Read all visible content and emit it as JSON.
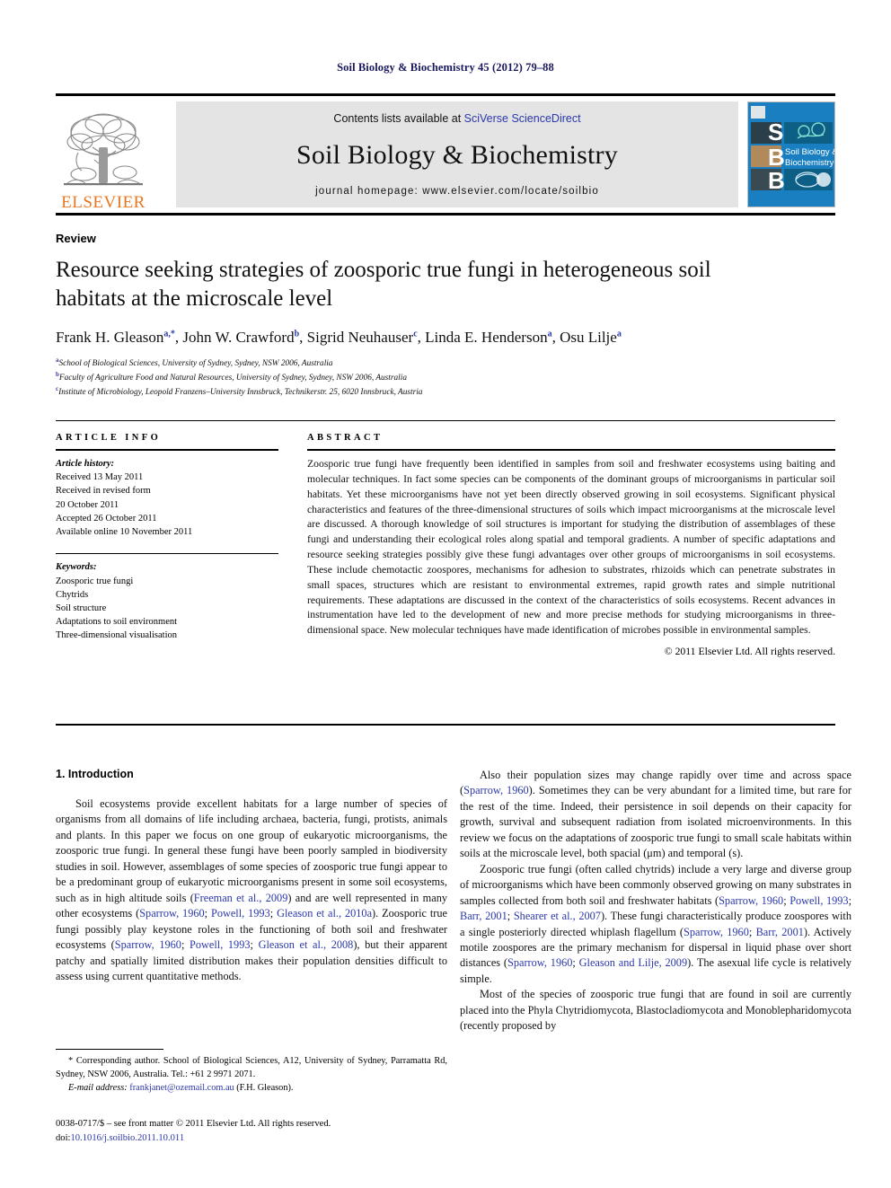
{
  "running_head": "Soil Biology & Biochemistry 45 (2012) 79–88",
  "masthead": {
    "publisher_name": "ELSEVIER",
    "contents_prefix": "Contents lists available at ",
    "contents_link": "SciVerse ScienceDirect",
    "journal_title": "Soil Biology & Biochemistry",
    "homepage": "journal homepage: www.elsevier.com/locate/soilbio",
    "cover_title_line1": "Soil Biology &",
    "cover_title_line2": "Biochemistry",
    "cover_letters": [
      "S",
      "B",
      "B"
    ],
    "colors": {
      "elsevier_orange": "#e87722",
      "link_blue": "#2b38a8",
      "cover_blue": "#1a7fc1",
      "contents_grey": "#e4e4e4",
      "running_head_navy": "#1a1a5e"
    }
  },
  "article": {
    "doctype": "Review",
    "title": "Resource seeking strategies of zoosporic true fungi in heterogeneous soil habitats at the microscale level",
    "authors": [
      {
        "name": "Frank H. Gleason",
        "marks": "a,*"
      },
      {
        "name": "John W. Crawford",
        "marks": "b"
      },
      {
        "name": "Sigrid Neuhauser",
        "marks": "c"
      },
      {
        "name": "Linda E. Henderson",
        "marks": "a"
      },
      {
        "name": "Osu Lilje",
        "marks": "a"
      }
    ],
    "affiliations": [
      {
        "mark": "a",
        "text": "School of Biological Sciences, University of Sydney, Sydney, NSW 2006, Australia"
      },
      {
        "mark": "b",
        "text": "Faculty of Agriculture Food and Natural Resources, University of Sydney, Sydney, NSW 2006, Australia"
      },
      {
        "mark": "c",
        "text": "Institute of Microbiology, Leopold Franzens–University Innsbruck, Technikerstr. 25, 6020 Innsbruck, Austria"
      }
    ]
  },
  "article_info": {
    "heading": "ARTICLE INFO",
    "history_label": "Article history:",
    "history": [
      "Received 13 May 2011",
      "Received in revised form",
      "20 October 2011",
      "Accepted 26 October 2011",
      "Available online 10 November 2011"
    ],
    "keywords_label": "Keywords:",
    "keywords": [
      "Zoosporic true fungi",
      "Chytrids",
      "Soil structure",
      "Adaptations to soil environment",
      "Three-dimensional visualisation"
    ]
  },
  "abstract": {
    "heading": "ABSTRACT",
    "text": "Zoosporic true fungi have frequently been identified in samples from soil and freshwater ecosystems using baiting and molecular techniques. In fact some species can be components of the dominant groups of microorganisms in particular soil habitats. Yet these microorganisms have not yet been directly observed growing in soil ecosystems. Significant physical characteristics and features of the three-dimensional structures of soils which impact microorganisms at the microscale level are discussed. A thorough knowledge of soil structures is important for studying the distribution of assemblages of these fungi and understanding their ecological roles along spatial and temporal gradients. A number of specific adaptations and resource seeking strategies possibly give these fungi advantages over other groups of microorganisms in soil ecosystems. These include chemotactic zoospores, mechanisms for adhesion to substrates, rhizoids which can penetrate substrates in small spaces, structures which are resistant to environmental extremes, rapid growth rates and simple nutritional requirements. These adaptations are discussed in the context of the characteristics of soils ecosystems. Recent advances in instrumentation have led to the development of new and more precise methods for studying microorganisms in three-dimensional space. New molecular techniques have made identification of microbes possible in environmental samples.",
    "copyright": "© 2011 Elsevier Ltd. All rights reserved."
  },
  "body": {
    "section_heading": "1. Introduction",
    "left_paragraph_1_parts": [
      {
        "t": "Soil ecosystems provide excellent habitats for a large number of species of organisms from all domains of life including archaea, bacteria, fungi, protists, animals and plants. In this paper we focus on one group of eukaryotic microorganisms, the zoosporic true fungi. In general these fungi have been poorly sampled in biodiversity studies in soil. However, assemblages of some species of zoosporic true fungi appear to be a predominant group of eukaryotic microorganisms present in some soil ecosystems, such as in high altitude soils (",
        "c": false
      },
      {
        "t": "Freeman et al., 2009",
        "c": true
      },
      {
        "t": ") and are well represented in many other ecosystems (",
        "c": false
      },
      {
        "t": "Sparrow, 1960",
        "c": true
      },
      {
        "t": "; ",
        "c": false
      },
      {
        "t": "Powell, 1993",
        "c": true
      },
      {
        "t": "; ",
        "c": false
      },
      {
        "t": "Gleason et al., 2010a",
        "c": true
      },
      {
        "t": "). Zoosporic true fungi possibly play keystone roles in the functioning of both soil and freshwater ecosystems (",
        "c": false
      },
      {
        "t": "Sparrow, 1960",
        "c": true
      },
      {
        "t": "; ",
        "c": false
      },
      {
        "t": "Powell, 1993",
        "c": true
      },
      {
        "t": "; ",
        "c": false
      },
      {
        "t": "Gleason et al., 2008",
        "c": true
      },
      {
        "t": "), but their apparent patchy and spatially limited distribution makes their population densities difficult to assess using current quantitative methods.",
        "c": false
      }
    ],
    "right_paragraph_1_parts": [
      {
        "t": "Also their population sizes may change rapidly over time and across space (",
        "c": false
      },
      {
        "t": "Sparrow, 1960",
        "c": true
      },
      {
        "t": "). Sometimes they can be very abundant for a limited time, but rare for the rest of the time. Indeed, their persistence in soil depends on their capacity for growth, survival and subsequent radiation from isolated microenvironments. In this review we focus on the adaptations of zoosporic true fungi to small scale habitats within soils at the microscale level, both spacial (μm) and temporal (s).",
        "c": false
      }
    ],
    "right_paragraph_2_parts": [
      {
        "t": "Zoosporic true fungi (often called chytrids) include a very large and diverse group of microorganisms which have been commonly observed growing on many substrates in samples collected from both soil and freshwater habitats (",
        "c": false
      },
      {
        "t": "Sparrow, 1960",
        "c": true
      },
      {
        "t": "; ",
        "c": false
      },
      {
        "t": "Powell, 1993",
        "c": true
      },
      {
        "t": "; ",
        "c": false
      },
      {
        "t": "Barr, 2001",
        "c": true
      },
      {
        "t": "; ",
        "c": false
      },
      {
        "t": "Shearer et al., 2007",
        "c": true
      },
      {
        "t": "). These fungi characteristically produce zoospores with a single posteriorly directed whiplash flagellum (",
        "c": false
      },
      {
        "t": "Sparrow, 1960",
        "c": true
      },
      {
        "t": "; ",
        "c": false
      },
      {
        "t": "Barr, 2001",
        "c": true
      },
      {
        "t": "). Actively motile zoospores are the primary mechanism for dispersal in liquid phase over short distances (",
        "c": false
      },
      {
        "t": "Sparrow, 1960",
        "c": true
      },
      {
        "t": "; ",
        "c": false
      },
      {
        "t": "Gleason and Lilje, 2009",
        "c": true
      },
      {
        "t": "). The asexual life cycle is relatively simple.",
        "c": false
      }
    ],
    "right_paragraph_3_parts": [
      {
        "t": "Most of the species of zoosporic true fungi that are found in soil are currently placed into the Phyla Chytridiomycota, Blastocladiomycota and Monoblepharidomycota (recently proposed by",
        "c": false
      }
    ]
  },
  "footnote": {
    "corresponding": "* Corresponding author. School of Biological Sciences, A12, University of Sydney, Parramatta Rd, Sydney, NSW 2006, Australia. Tel.: +61 2 9971 2071.",
    "email_label": "E-mail address:",
    "email": "frankjanet@ozemail.com.au",
    "email_suffix": "(F.H. Gleason).",
    "issn_line": "0038-0717/$ – see front matter © 2011 Elsevier Ltd. All rights reserved.",
    "doi_label": "doi:",
    "doi": "10.1016/j.soilbio.2011.10.011"
  }
}
